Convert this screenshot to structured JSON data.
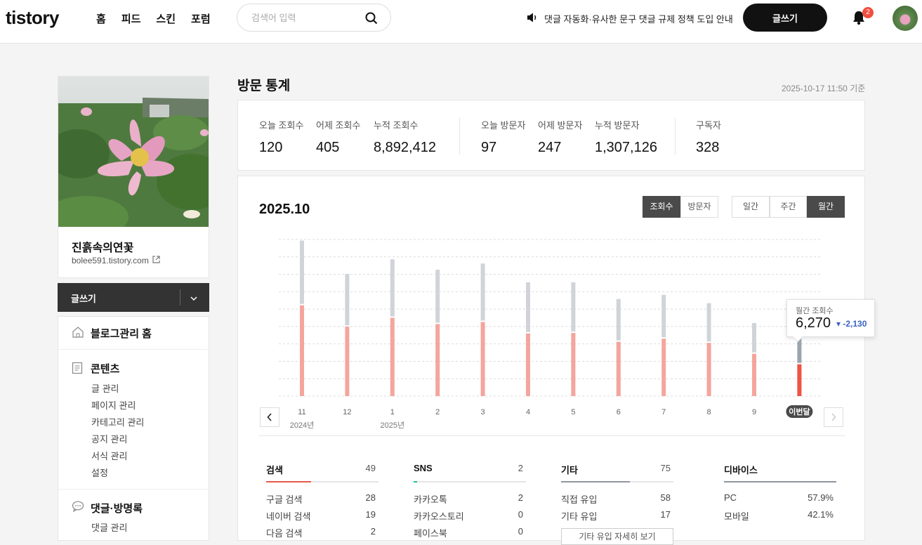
{
  "header": {
    "logo": "tistory",
    "nav": [
      "홈",
      "피드",
      "스킨",
      "포럼"
    ],
    "search_placeholder": "검색어 입력",
    "notice": "댓글 자동화·유사한 문구 댓글 규제 정책 도입 안내",
    "write_label": "글쓰기",
    "notification_count": "2"
  },
  "sidebar": {
    "blog_name": "진흙속의연꽃",
    "blog_url": "bolee591.tistory.com",
    "write_label": "글쓰기",
    "menu": {
      "home": "블로그관리 홈",
      "contents": "콘텐츠",
      "contents_items": [
        "글 관리",
        "페이지 관리",
        "카테고리 관리",
        "공지 관리",
        "서식 관리",
        "설정"
      ],
      "comments": "댓글·방명록",
      "comments_items": [
        "댓글 관리"
      ]
    }
  },
  "main": {
    "title": "방문 통계",
    "ref_time": "2025-10-17 11:50 기준",
    "stats": [
      {
        "label": "오늘 조회수",
        "value": "120"
      },
      {
        "label": "어제 조회수",
        "value": "405"
      },
      {
        "label": "누적 조회수",
        "value": "8,892,412"
      },
      {
        "label": "오늘 방문자",
        "value": "97"
      },
      {
        "label": "어제 방문자",
        "value": "247"
      },
      {
        "label": "누적 방문자",
        "value": "1,307,126"
      },
      {
        "label": "구독자",
        "value": "328"
      }
    ],
    "chart_period": "2025.10",
    "metric_toggle": [
      "조회수",
      "방문자"
    ],
    "period_toggle": [
      "일간",
      "주간",
      "월간"
    ],
    "tooltip": {
      "label": "월간 조회수",
      "value": "6,270",
      "delta": "-2,130"
    },
    "referrers": [
      {
        "title": "검색",
        "count": "49",
        "fill": 0.4,
        "color": "#e8584b",
        "rows": [
          {
            "k": "구글 검색",
            "v": "28"
          },
          {
            "k": "네이버 검색",
            "v": "19"
          },
          {
            "k": "다음 검색",
            "v": "2"
          }
        ]
      },
      {
        "title": "SNS",
        "count": "2",
        "fill": 0.03,
        "color": "#19c3a1",
        "rows": [
          {
            "k": "카카오톡",
            "v": "2"
          },
          {
            "k": "카카오스토리",
            "v": "0"
          },
          {
            "k": "페이스북",
            "v": "0"
          }
        ]
      },
      {
        "title": "기타",
        "count": "75",
        "fill": 0.61,
        "color": "#8e97a0",
        "rows": [
          {
            "k": "직접 유입",
            "v": "58"
          },
          {
            "k": "기타 유입",
            "v": "17"
          }
        ],
        "detail_button": "기타 유입 자세히 보기"
      },
      {
        "title": "디바이스",
        "count": "",
        "fill": 1.0,
        "color": "#8e97a0",
        "rows": [
          {
            "k": "PC",
            "v": "57.9%"
          },
          {
            "k": "모바일",
            "v": "42.1%"
          }
        ]
      }
    ]
  },
  "chart_data": {
    "type": "bar",
    "categories": [
      "11",
      "12",
      "1",
      "2",
      "3",
      "4",
      "5",
      "6",
      "7",
      "8",
      "9",
      "이번달"
    ],
    "year_labels": [
      {
        "index": 0,
        "label": "2024년"
      },
      {
        "index": 2,
        "label": "2025년"
      }
    ],
    "series": [
      {
        "name": "방문자",
        "values": [
          8700,
          6650,
          7500,
          6900,
          7100,
          6000,
          6050,
          5200,
          5500,
          5100,
          4050,
          3050
        ]
      },
      {
        "name": "조회수",
        "values": [
          14900,
          11700,
          13100,
          12100,
          12700,
          10900,
          10900,
          9300,
          9700,
          8900,
          7000,
          6270
        ]
      }
    ],
    "colors": {
      "visitors": "#f4a59d",
      "views": "#d0d4d9",
      "current_visitors": "#ee5444",
      "current_views": "#9aa4ae"
    },
    "ylim": [
      0,
      15000
    ],
    "grid": true
  }
}
